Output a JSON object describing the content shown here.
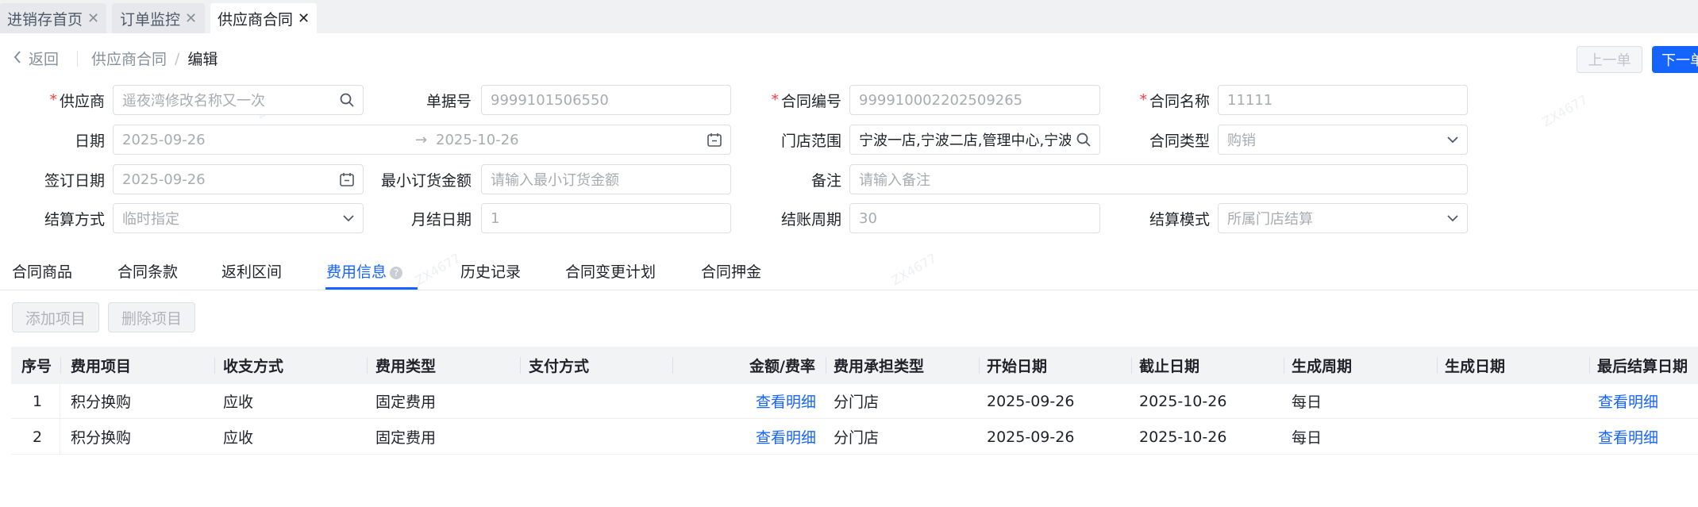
{
  "top_tabs": [
    {
      "label": "进销存首页",
      "close": "✕"
    },
    {
      "label": "订单监控",
      "close": "✕"
    },
    {
      "label": "供应商合同",
      "close": "✕"
    }
  ],
  "header": {
    "back_label": "返回",
    "breadcrumb_parent": "供应商合同",
    "breadcrumb_sep": "/",
    "breadcrumb_current": "编辑",
    "prev_label": "上一单",
    "next_label": "下一单"
  },
  "form": {
    "supplier_label": "供应商",
    "supplier_value": "遥夜湾修改名称又一次",
    "doc_no_label": "单据号",
    "doc_no_value": "9999101506550",
    "contract_no_label": "合同编号",
    "contract_no_value": "999910002202509265",
    "contract_name_label": "合同名称",
    "contract_name_value": "11111",
    "date_label": "日期",
    "date_start": "2025-09-26",
    "date_arrow": "→",
    "date_end": "2025-10-26",
    "store_scope_label": "门店范围",
    "store_scope_value": "宁波一店,宁波二店,管理中心,宁波三店",
    "contract_type_label": "合同类型",
    "contract_type_value": "购销",
    "sign_date_label": "签订日期",
    "sign_date_value": "2025-09-26",
    "min_order_label": "最小订货金额",
    "min_order_placeholder": "请输入最小订货金额",
    "remark_label": "备注",
    "remark_placeholder": "请输入备注",
    "settle_method_label": "结算方式",
    "settle_method_value": "临时指定",
    "monthly_date_label": "月结日期",
    "monthly_date_value": "1",
    "billing_cycle_label": "结账周期",
    "billing_cycle_value": "30",
    "settle_mode_label": "结算模式",
    "settle_mode_value": "所属门店结算"
  },
  "content_tabs": [
    "合同商品",
    "合同条款",
    "返利区间",
    "费用信息",
    "历史记录",
    "合同变更计划",
    "合同押金"
  ],
  "active_tab": "费用信息",
  "actions": {
    "add_label": "添加项目",
    "delete_label": "删除项目"
  },
  "table": {
    "columns": [
      "序号",
      "费用项目",
      "收支方式",
      "费用类型",
      "支付方式",
      "金额/费率",
      "费用承担类型",
      "开始日期",
      "截止日期",
      "生成周期",
      "生成日期",
      "最后结算日期"
    ],
    "rows": [
      {
        "index": "1",
        "item": "积分换购",
        "direction": "应收",
        "fee_type": "固定费用",
        "pay_method": "",
        "amount": "查看明细",
        "bearer": "分门店",
        "start": "2025-09-26",
        "end": "2025-10-26",
        "cycle": "每日",
        "gen_date": "",
        "last_settle": "查看明细"
      },
      {
        "index": "2",
        "item": "积分换购",
        "direction": "应收",
        "fee_type": "固定费用",
        "pay_method": "",
        "amount": "查看明细",
        "bearer": "分门店",
        "start": "2025-09-26",
        "end": "2025-10-26",
        "cycle": "每日",
        "gen_date": "",
        "last_settle": "查看明细"
      }
    ]
  },
  "colors": {
    "primary": "#1664ff",
    "required": "#f53f3f",
    "header_bg": "#f2f3f5"
  }
}
